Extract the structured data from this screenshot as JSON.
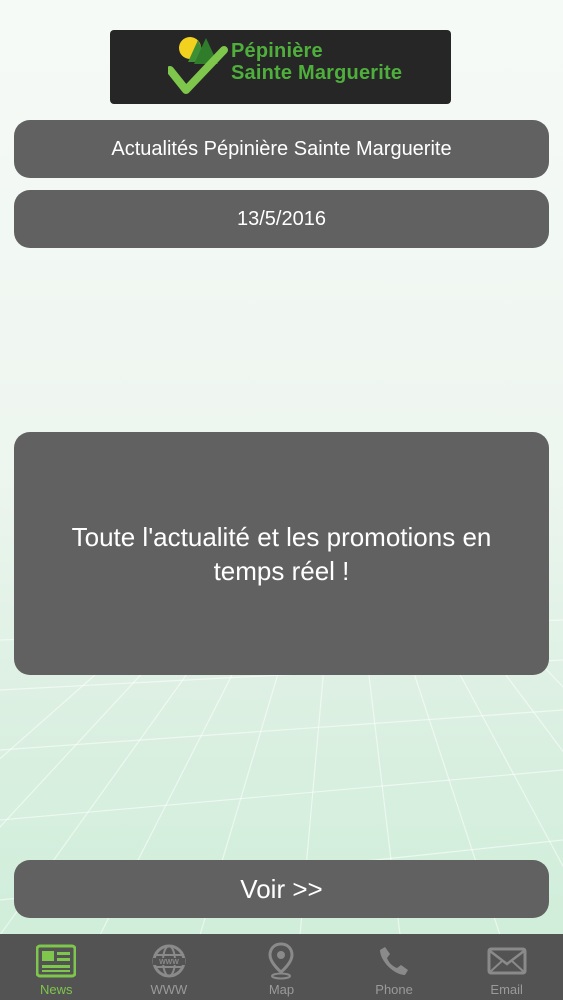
{
  "logo": {
    "line1": "Pépinière",
    "line2": "Sainte Marguerite",
    "text_color": "#4faf3c"
  },
  "header": {
    "title": "Actualités Pépinière Sainte Marguerite",
    "date": "13/5/2016"
  },
  "content": {
    "text": "Toute l'actualité et les promotions en temps réel !"
  },
  "actions": {
    "voir_label": "Voir >>"
  },
  "tabbar": {
    "active_color": "#7ec64c",
    "inactive_color": "#9a9a9a",
    "tabs": [
      {
        "label": "News",
        "icon": "newspaper-icon",
        "active": true
      },
      {
        "label": "WWW",
        "icon": "globe-icon",
        "active": false
      },
      {
        "label": "Map",
        "icon": "map-pin-icon",
        "active": false
      },
      {
        "label": "Phone",
        "icon": "phone-icon",
        "active": false
      },
      {
        "label": "Email",
        "icon": "envelope-icon",
        "active": false
      }
    ]
  }
}
